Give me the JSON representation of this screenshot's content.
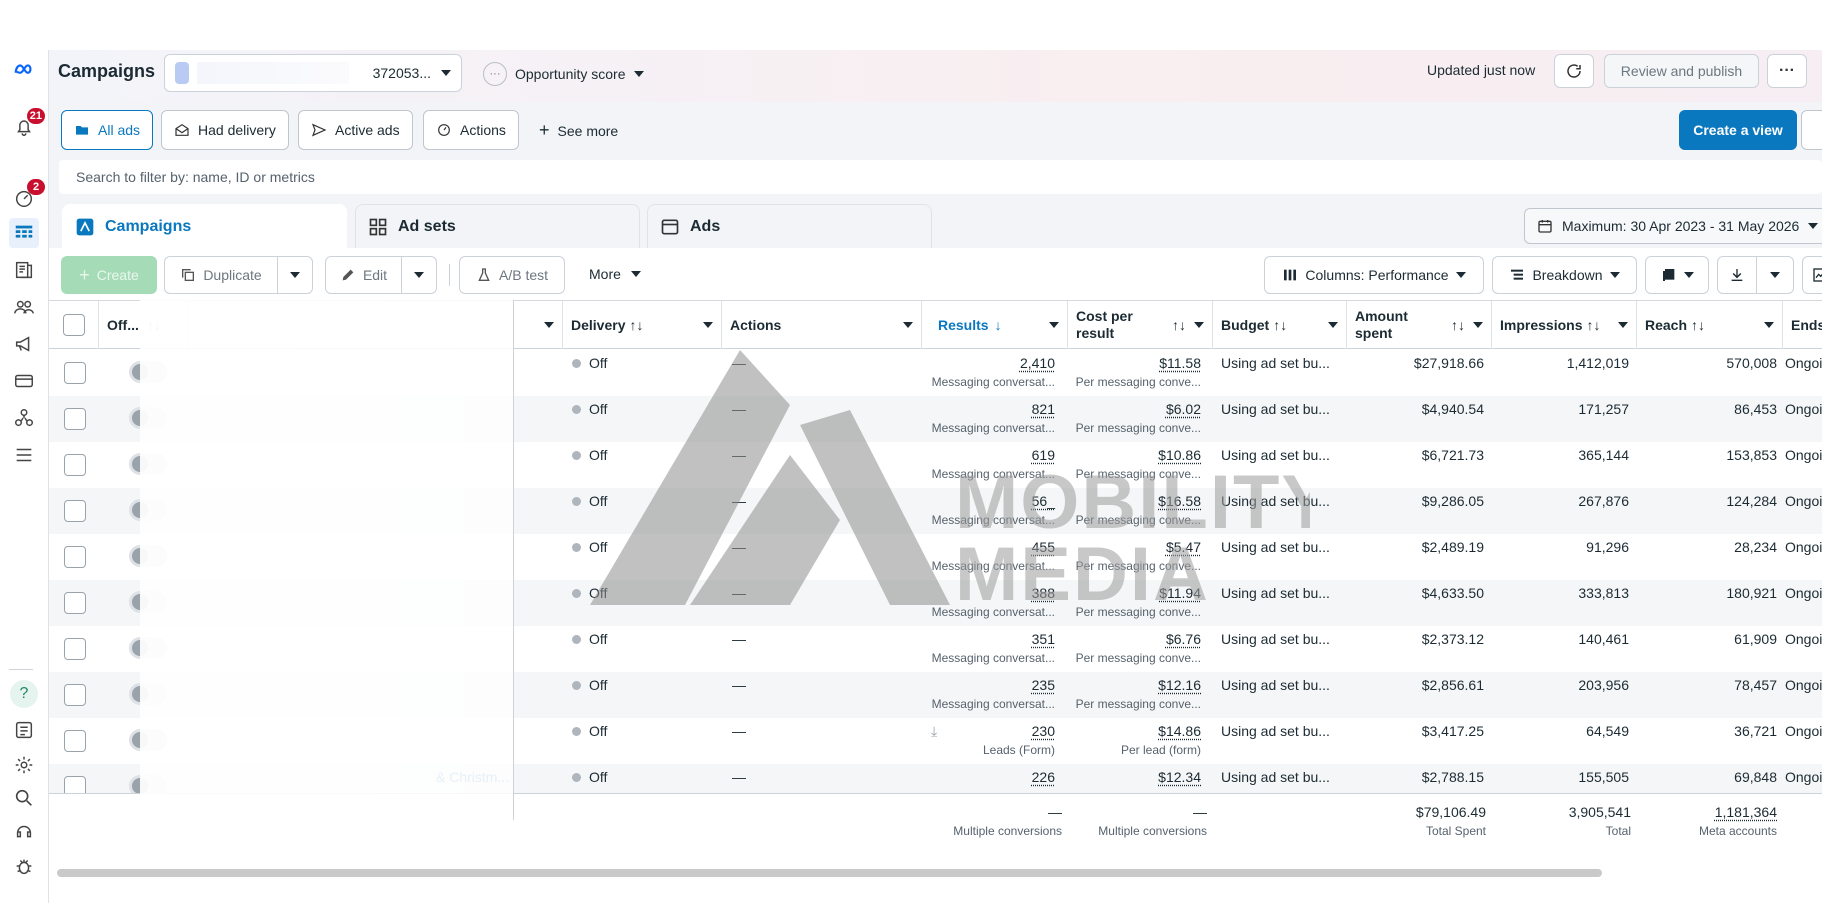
{
  "header": {
    "title": "Campaigns",
    "account_suffix": "372053...",
    "opportunity_label": "Opportunity score",
    "opportunity_dots": "···",
    "updated": "Updated just now",
    "review_publish": "Review and publish",
    "more_dots": "···"
  },
  "rail": {
    "notifications_badge": "21",
    "alerts_badge": "2"
  },
  "filters": {
    "all_ads": "All ads",
    "had_delivery": "Had delivery",
    "active_ads": "Active ads",
    "actions": "Actions",
    "see_more": "See more",
    "create_view": "Create a view"
  },
  "search": {
    "placeholder": "Search to filter by: name, ID or metrics"
  },
  "tabs": {
    "campaigns": "Campaigns",
    "ad_sets": "Ad sets",
    "ads": "Ads"
  },
  "date_range": "Maximum: 30 Apr 2023 - 31 May 2026",
  "toolbar": {
    "create": "Create",
    "duplicate": "Duplicate",
    "edit": "Edit",
    "ab_test": "A/B test",
    "more": "More",
    "columns": "Columns: Performance",
    "breakdown": "Breakdown"
  },
  "columns": {
    "off": "Off...",
    "delivery": "Delivery",
    "actions": "Actions",
    "results": "Results",
    "cost_per_result_1": "Cost per",
    "cost_per_result_2": "result",
    "budget": "Budget",
    "amount_spent_1": "Amount",
    "amount_spent_2": "spent",
    "impressions": "Impressions",
    "reach": "Reach",
    "ends": "Ends"
  },
  "rows": [
    {
      "delivery": "Off",
      "actions": "—",
      "results": "2,410",
      "results_sub": "Messaging conversat...",
      "cost": "$11.58",
      "cost_sub": "Per messaging conve...",
      "budget": "Using ad set bu...",
      "spent": "$27,918.66",
      "impressions": "1,412,019",
      "reach": "570,008",
      "ends": "Ongoi"
    },
    {
      "delivery": "Off",
      "actions": "—",
      "results": "821",
      "results_sub": "Messaging conversat...",
      "cost": "$6.02",
      "cost_sub": "Per messaging conve...",
      "budget": "Using ad set bu...",
      "spent": "$4,940.54",
      "impressions": "171,257",
      "reach": "86,453",
      "ends": "Ongoi"
    },
    {
      "delivery": "Off",
      "actions": "—",
      "results": "619",
      "results_sub": "Messaging conversat...",
      "cost": "$10.86",
      "cost_sub": "Per messaging conve...",
      "budget": "Using ad set bu...",
      "spent": "$6,721.73",
      "impressions": "365,144",
      "reach": "153,853",
      "ends": "Ongoi"
    },
    {
      "delivery": "Off",
      "actions": "—",
      "results": "56_",
      "results_sub": "Messaging conversat...",
      "cost": "$16.58",
      "cost_sub": "Per messaging conve...",
      "budget": "Using ad set bu...",
      "spent": "$9,286.05",
      "impressions": "267,876",
      "reach": "124,284",
      "ends": "Ongoi"
    },
    {
      "delivery": "Off",
      "actions": "—",
      "results": "455",
      "results_sub": "Messaging conversat...",
      "cost": "$5.47",
      "cost_sub": "Per messaging conve...",
      "budget": "Using ad set bu...",
      "spent": "$2,489.19",
      "impressions": "91,296",
      "reach": "28,234",
      "ends": "Ongoi"
    },
    {
      "delivery": "Off",
      "actions": "—",
      "results": "388",
      "results_sub": "Messaging conversat...",
      "cost": "$11.94",
      "cost_sub": "Per messaging conve...",
      "budget": "Using ad set bu...",
      "spent": "$4,633.50",
      "impressions": "333,813",
      "reach": "180,921",
      "ends": "Ongoi"
    },
    {
      "delivery": "Off",
      "actions": "—",
      "results": "351",
      "results_sub": "Messaging conversat...",
      "cost": "$6.76",
      "cost_sub": "Per messaging conve...",
      "budget": "Using ad set bu...",
      "spent": "$2,373.12",
      "impressions": "140,461",
      "reach": "61,909",
      "ends": "Ongoi"
    },
    {
      "delivery": "Off",
      "actions": "—",
      "results": "235",
      "results_sub": "Messaging conversat...",
      "cost": "$12.16",
      "cost_sub": "Per messaging conve...",
      "budget": "Using ad set bu...",
      "spent": "$2,856.61",
      "impressions": "203,956",
      "reach": "78,457",
      "ends": "Ongoi"
    },
    {
      "delivery": "Off",
      "actions": "—",
      "results": "230",
      "results_sub": "Leads (Form)",
      "cost": "$14.86",
      "cost_sub": "Per lead (form)",
      "budget": "Using ad set bu...",
      "spent": "$3,417.25",
      "impressions": "64,549",
      "reach": "36,721",
      "ends": "Ongoi"
    },
    {
      "delivery": "Off",
      "actions": "—",
      "results": "226",
      "results_sub": "",
      "cost": "$12.34",
      "cost_sub": "",
      "budget": "Using ad set bu...",
      "spent": "$2,788.15",
      "impressions": "155,505",
      "reach": "69,848",
      "ends": "Ongoi",
      "name_fragment": "& Christm..."
    }
  ],
  "totals": {
    "results": "—",
    "results_sub": "Multiple conversions",
    "cost": "—",
    "cost_sub": "Multiple conversions",
    "spent": "$79,106.49",
    "spent_sub": "Total Spent",
    "impressions": "3,905,541",
    "impressions_sub": "Total",
    "reach": "1,181,364",
    "reach_sub": "Meta accounts"
  },
  "watermark": {
    "line1": "MOBILITY",
    "line2": "MEDIA"
  },
  "colors": {
    "accent": "#0a78be",
    "create_disabled": "#a5dbb7",
    "badge": "#c8102e"
  }
}
